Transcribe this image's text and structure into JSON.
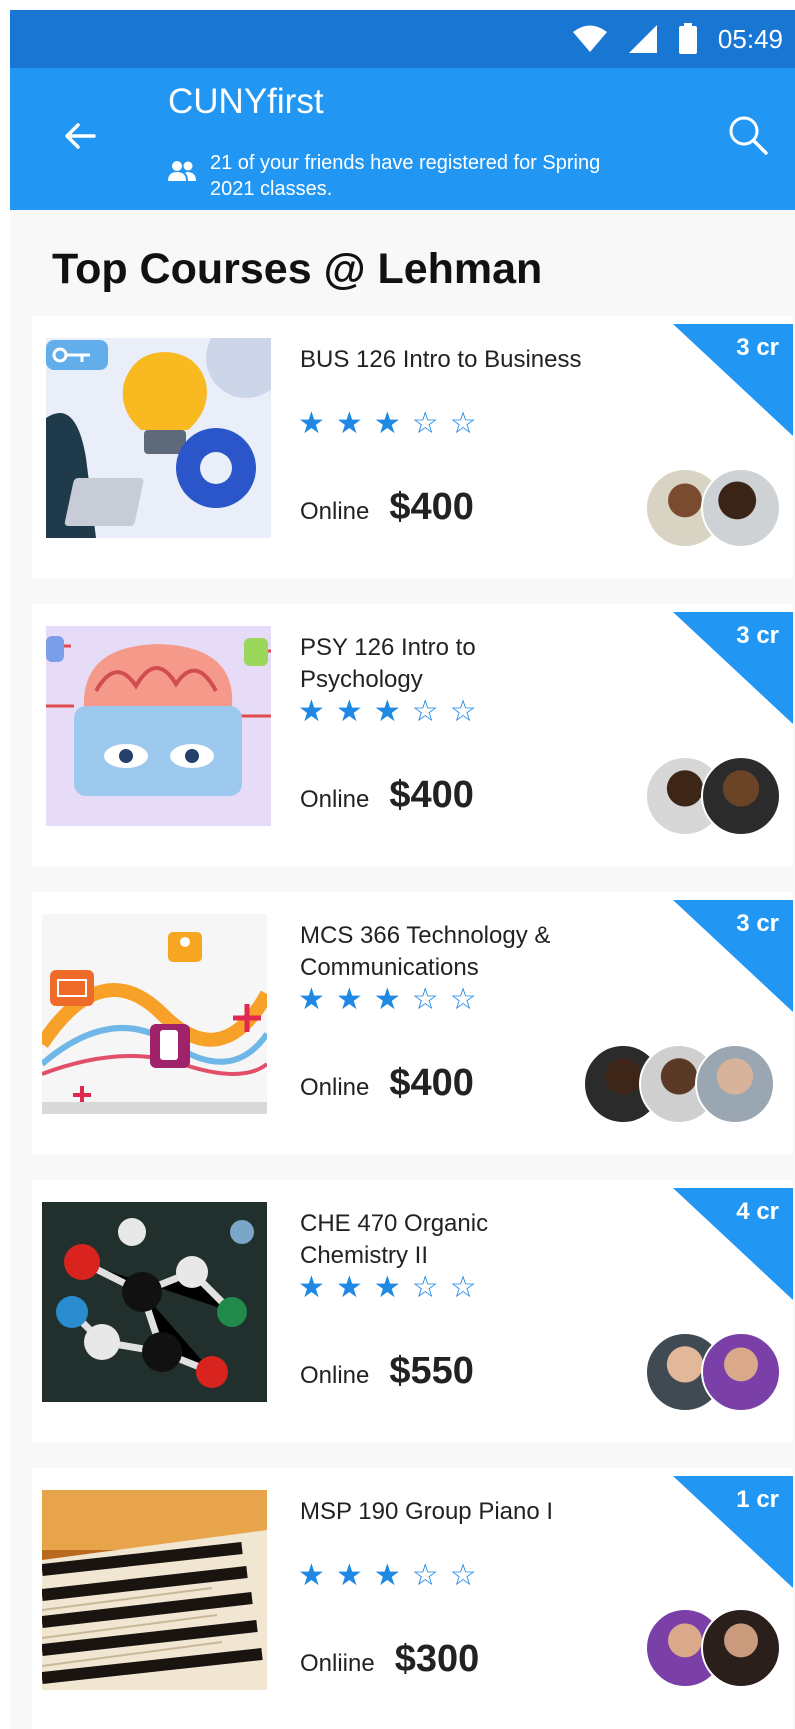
{
  "status_bar": {
    "time": "05:49",
    "icons": [
      "wifi-icon",
      "cell-signal-icon",
      "battery-icon"
    ]
  },
  "app_bar": {
    "title": "CUNYfirst",
    "friends_note": "21 of your friends have registered for Spring 2021 classes.",
    "icons": [
      "back-arrow-icon",
      "friends-icon",
      "search-icon"
    ]
  },
  "section_title": "Top Courses @ Lehman",
  "colors": {
    "primary": "#2196f3",
    "status_bar": "#1976d2",
    "star": "#1e88e5"
  },
  "courses": [
    {
      "title": "BUS 126 Intro to Business",
      "credits": "3 cr",
      "mode": "Online",
      "price": "$400",
      "rating": 3,
      "rating_max": 5,
      "friends_count": 2,
      "image": "business-illustration"
    },
    {
      "title": "PSY 126 Intro to Psychology",
      "credits": "3 cr",
      "mode": "Online",
      "price": "$400",
      "rating": 3,
      "rating_max": 5,
      "friends_count": 2,
      "image": "brain-illustration"
    },
    {
      "title": "MCS 366 Technology & Communications",
      "credits": "3 cr",
      "mode": "Online",
      "price": "$400",
      "rating": 3,
      "rating_max": 5,
      "friends_count": 3,
      "image": "communications-illustration"
    },
    {
      "title": "CHE 470 Organic Chemistry II",
      "credits": "4 cr",
      "mode": "Online",
      "price": "$550",
      "rating": 3,
      "rating_max": 5,
      "friends_count": 2,
      "image": "molecule-photo"
    },
    {
      "title": "MSP 190 Group Piano I",
      "credits": "1 cr",
      "mode": "Onliine",
      "price": "$300",
      "rating": 3,
      "rating_max": 5,
      "friends_count": 2,
      "image": "piano-keys-photo"
    }
  ]
}
